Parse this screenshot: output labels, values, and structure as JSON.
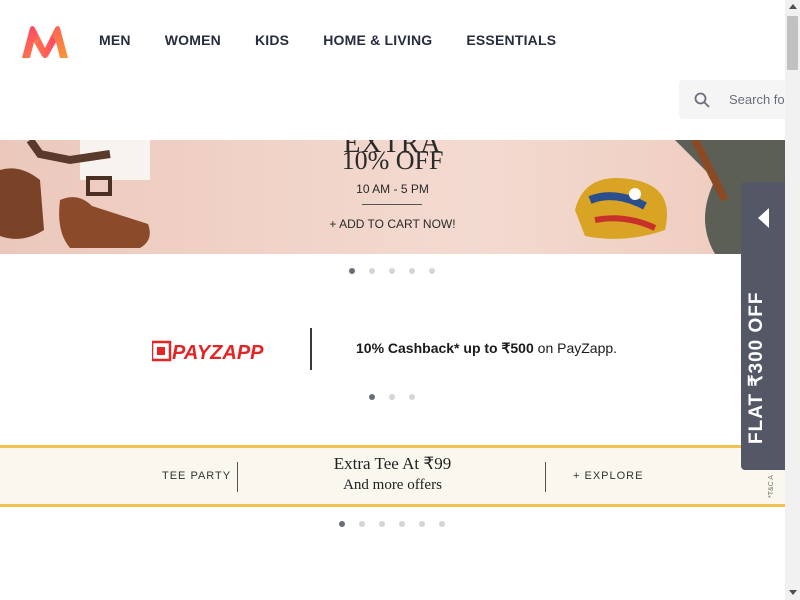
{
  "header": {
    "nav": [
      "MEN",
      "WOMEN",
      "KIDS",
      "HOME & LIVING",
      "ESSENTIALS"
    ],
    "search_placeholder": "Search for"
  },
  "hero_banner": {
    "line1": "EXTRA",
    "line2": "10% OFF",
    "line3": "10 AM - 5 PM",
    "line4": "+ ADD TO CART NOW!",
    "dots": {
      "count": 5,
      "active": 0
    }
  },
  "payzapp_banner": {
    "logo_text": "PAYZAPP",
    "offer_bold": "10% Cashback* up to ₹500",
    "offer_rest": " on PayZapp.",
    "dots": {
      "count": 3,
      "active": 0
    }
  },
  "tee_banner": {
    "left": "TEE PARTY",
    "title": "Extra Tee At ₹99",
    "subtitle": "And more offers",
    "right": "+ EXPLORE",
    "tc": "*T&C A",
    "dots": {
      "count": 6,
      "active": 0
    }
  },
  "side_offer": {
    "text": "FLAT ₹300 OFF"
  },
  "colors": {
    "brand_pink": "#ff3f6c",
    "brand_orange": "#f89b33",
    "side_offer_bg": "#535766",
    "tee_border": "#f1c14c",
    "payzapp_red": "#e42527"
  }
}
